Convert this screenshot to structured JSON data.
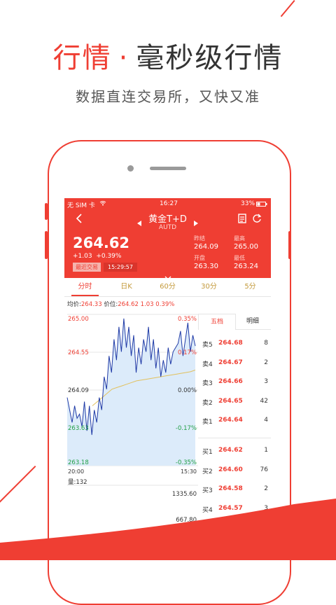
{
  "promo": {
    "title_accent": "行情",
    "title_dot": "·",
    "title_rest": "毫秒级行情",
    "subtitle": "数据直连交易所，又快又准"
  },
  "colors": {
    "accent": "#ef3e33",
    "gold": "#c49a3c",
    "line": "#1f3aa6",
    "avg": "#e2c15d",
    "fill": "#dcebfa"
  },
  "status_bar": {
    "carrier": "无 SIM 卡",
    "wifi_icon": "wifi-icon",
    "time": "16:27",
    "battery": "33%"
  },
  "nav": {
    "title": "黄金T+D",
    "subtitle": "AUTD"
  },
  "quote": {
    "price": "264.62",
    "change": "+1.03",
    "change_pct": "+0.39%",
    "badge": "最近交易",
    "trade_time": "15:29:57",
    "stats": [
      {
        "label": "昨结",
        "value": "264.09"
      },
      {
        "label": "最高",
        "value": "265.00"
      },
      {
        "label": "开盘",
        "value": "263.30"
      },
      {
        "label": "最低",
        "value": "263.24"
      }
    ]
  },
  "tabs": [
    "分时",
    "日K",
    "60分",
    "30分",
    "5分"
  ],
  "info": {
    "avg_label": "均价:",
    "avg_value": "264.33",
    "price_label": "价位:",
    "price_value": "264.62",
    "chg": "1.03",
    "pct": "0.39%"
  },
  "chart_data": {
    "type": "line",
    "price_axis": [
      "265.00",
      "264.55",
      "264.09",
      "263.63",
      "263.18"
    ],
    "pct_axis": [
      "0.35%",
      "0.17%",
      "0.00%",
      "-0.17%",
      "-0.35%"
    ],
    "time_axis": [
      "20:00",
      "15:30"
    ],
    "ylim": [
      263.18,
      265.0
    ],
    "series": [
      {
        "values": [
          264.0,
          263.85,
          263.7,
          263.9,
          263.75,
          263.8,
          263.65,
          263.95,
          263.6,
          263.9,
          263.55,
          263.85,
          263.7,
          264.0,
          263.85,
          264.25,
          264.1,
          264.5,
          264.3,
          264.7,
          264.45,
          264.85,
          264.55,
          264.95,
          264.6,
          264.85,
          264.5,
          264.75,
          264.3,
          264.6,
          264.4,
          264.7,
          264.55,
          264.85,
          264.45,
          264.7,
          264.35,
          264.6,
          264.25,
          264.45,
          264.3,
          264.6,
          264.4,
          264.55,
          264.6,
          264.65,
          264.8,
          264.5,
          264.7,
          264.9,
          264.55,
          264.75,
          264.62
        ]
      },
      {
        "values": [
          263.9,
          263.95,
          264.0,
          264.05,
          264.1,
          264.12,
          264.14,
          264.16,
          264.18,
          264.2,
          264.21,
          264.22,
          264.23,
          264.24,
          264.25,
          264.26,
          264.27,
          264.28,
          264.29,
          264.3,
          264.31,
          264.33
        ]
      }
    ]
  },
  "volume": {
    "label": "量:132",
    "axis": [
      "1335.60",
      "667.80"
    ],
    "values": [
      0.05,
      0.08,
      0.15,
      0.06,
      0.1,
      0.25,
      0.04,
      0.12,
      0.3,
      0.18,
      0.07,
      0.14,
      0.1,
      0.06,
      0.2,
      0.08
    ]
  },
  "orderbook": {
    "tabs": [
      "五档",
      "明细"
    ],
    "asks": [
      {
        "label": "卖5",
        "price": "264.68",
        "vol": "8"
      },
      {
        "label": "卖4",
        "price": "264.67",
        "vol": "2"
      },
      {
        "label": "卖3",
        "price": "264.66",
        "vol": "3"
      },
      {
        "label": "卖2",
        "price": "264.65",
        "vol": "42"
      },
      {
        "label": "卖1",
        "price": "264.64",
        "vol": "4"
      }
    ],
    "bids": [
      {
        "label": "买1",
        "price": "264.62",
        "vol": "1"
      },
      {
        "label": "买2",
        "price": "264.60",
        "vol": "76"
      },
      {
        "label": "买3",
        "price": "264.58",
        "vol": "2"
      },
      {
        "label": "买4",
        "price": "264.57",
        "vol": "3"
      }
    ]
  }
}
